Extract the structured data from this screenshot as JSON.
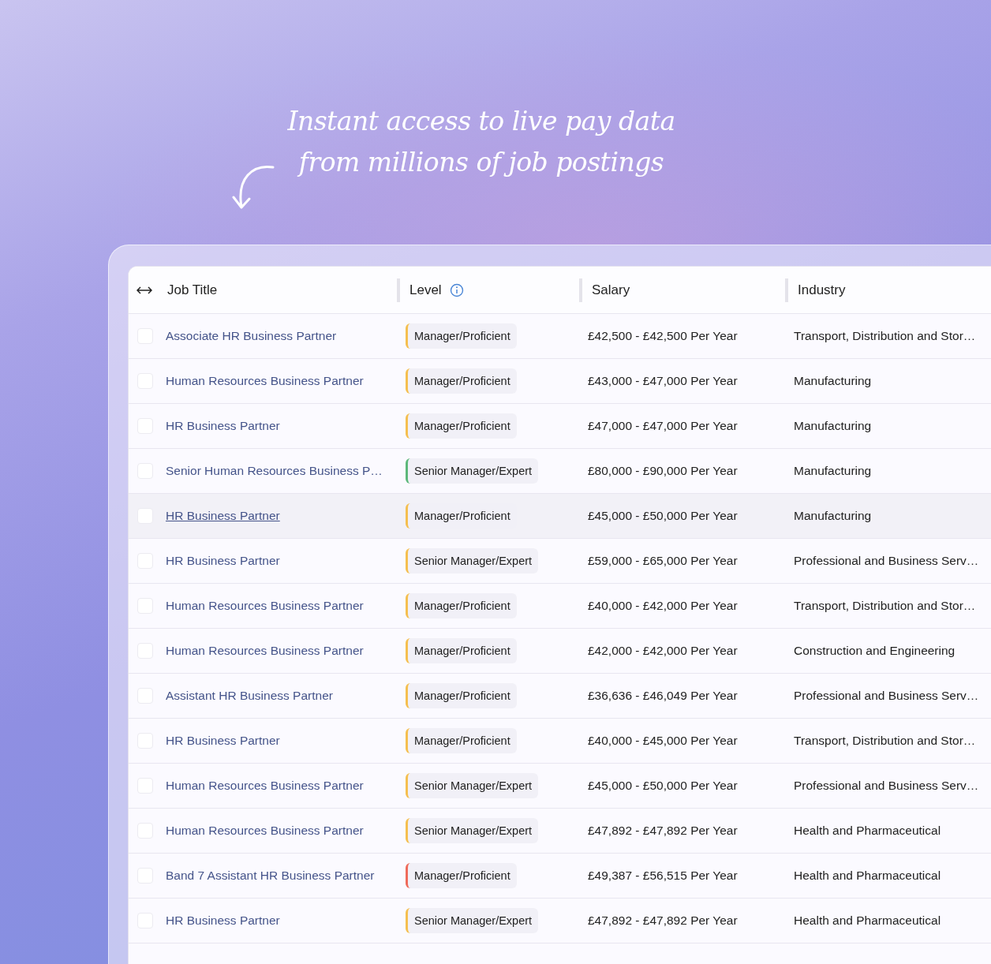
{
  "caption": {
    "lines": [
      "Instant access to live pay data",
      "from millions of job postings"
    ]
  },
  "table": {
    "columns": [
      {
        "label": "Job Title",
        "kind": "resize"
      },
      {
        "label": "Level",
        "kind": "info"
      },
      {
        "label": "Salary",
        "kind": "plain"
      },
      {
        "label": "Industry",
        "kind": "plain"
      }
    ],
    "rows": [
      {
        "checked": false,
        "hovered": false,
        "title": "Associate HR Business Partner",
        "level": "Manager/Proficient",
        "color": "#f5bf4f",
        "salary": "£42,500 - £42,500 Per Year",
        "industry": "Transport, Distribution and Stor…"
      },
      {
        "checked": false,
        "hovered": false,
        "title": "Human Resources Business Partner",
        "level": "Manager/Proficient",
        "color": "#f5bf4f",
        "salary": "£43,000 - £47,000 Per Year",
        "industry": "Manufacturing"
      },
      {
        "checked": false,
        "hovered": false,
        "title": "HR Business Partner",
        "level": "Manager/Proficient",
        "color": "#f5bf4f",
        "salary": "£47,000 - £47,000 Per Year",
        "industry": "Manufacturing"
      },
      {
        "checked": false,
        "hovered": false,
        "title": "Senior Human Resources Business P…",
        "level": "Senior Manager/Expert",
        "color": "#5cb87a",
        "salary": "£80,000 - £90,000 Per Year",
        "industry": "Manufacturing"
      },
      {
        "checked": false,
        "hovered": true,
        "title": "HR Business Partner",
        "level": "Manager/Proficient",
        "color": "#f5bf4f",
        "salary": "£45,000 - £50,000 Per Year",
        "industry": "Manufacturing"
      },
      {
        "checked": false,
        "hovered": false,
        "title": "HR Business Partner",
        "level": "Senior Manager/Expert",
        "color": "#f5bf4f",
        "salary": "£59,000 - £65,000 Per Year",
        "industry": "Professional and Business Serv…"
      },
      {
        "checked": false,
        "hovered": false,
        "title": "Human Resources Business Partner",
        "level": "Manager/Proficient",
        "color": "#f5bf4f",
        "salary": "£40,000 - £42,000 Per Year",
        "industry": "Transport, Distribution and Stor…"
      },
      {
        "checked": false,
        "hovered": false,
        "title": "Human Resources Business Partner",
        "level": "Manager/Proficient",
        "color": "#f5bf4f",
        "salary": "£42,000 - £42,000 Per Year",
        "industry": "Construction and Engineering"
      },
      {
        "checked": false,
        "hovered": false,
        "title": "Assistant HR Business Partner",
        "level": "Manager/Proficient",
        "color": "#f5bf4f",
        "salary": "£36,636 - £46,049 Per Year",
        "industry": "Professional and Business Serv…"
      },
      {
        "checked": false,
        "hovered": false,
        "title": "HR Business Partner",
        "level": "Manager/Proficient",
        "color": "#f5bf4f",
        "salary": "£40,000 - £45,000 Per Year",
        "industry": "Transport, Distribution and Stor…"
      },
      {
        "checked": false,
        "hovered": false,
        "title": "Human Resources Business Partner",
        "level": "Senior Manager/Expert",
        "color": "#f5bf4f",
        "salary": "£45,000 - £50,000 Per Year",
        "industry": "Professional and Business Serv…"
      },
      {
        "checked": false,
        "hovered": false,
        "title": "Human Resources Business Partner",
        "level": "Senior Manager/Expert",
        "color": "#f5bf4f",
        "salary": "£47,892 - £47,892 Per Year",
        "industry": "Health and Pharmaceutical"
      },
      {
        "checked": false,
        "hovered": false,
        "title": "Band 7 Assistant HR Business Partner",
        "level": "Manager/Proficient",
        "color": "#ef6a5a",
        "salary": "£49,387 - £56,515 Per Year",
        "industry": "Health and Pharmaceutical"
      },
      {
        "checked": false,
        "hovered": false,
        "title": "HR Business Partner",
        "level": "Senior Manager/Expert",
        "color": "#f5bf4f",
        "salary": "£47,892 - £47,892 Per Year",
        "industry": "Health and Pharmaceutical"
      }
    ]
  }
}
